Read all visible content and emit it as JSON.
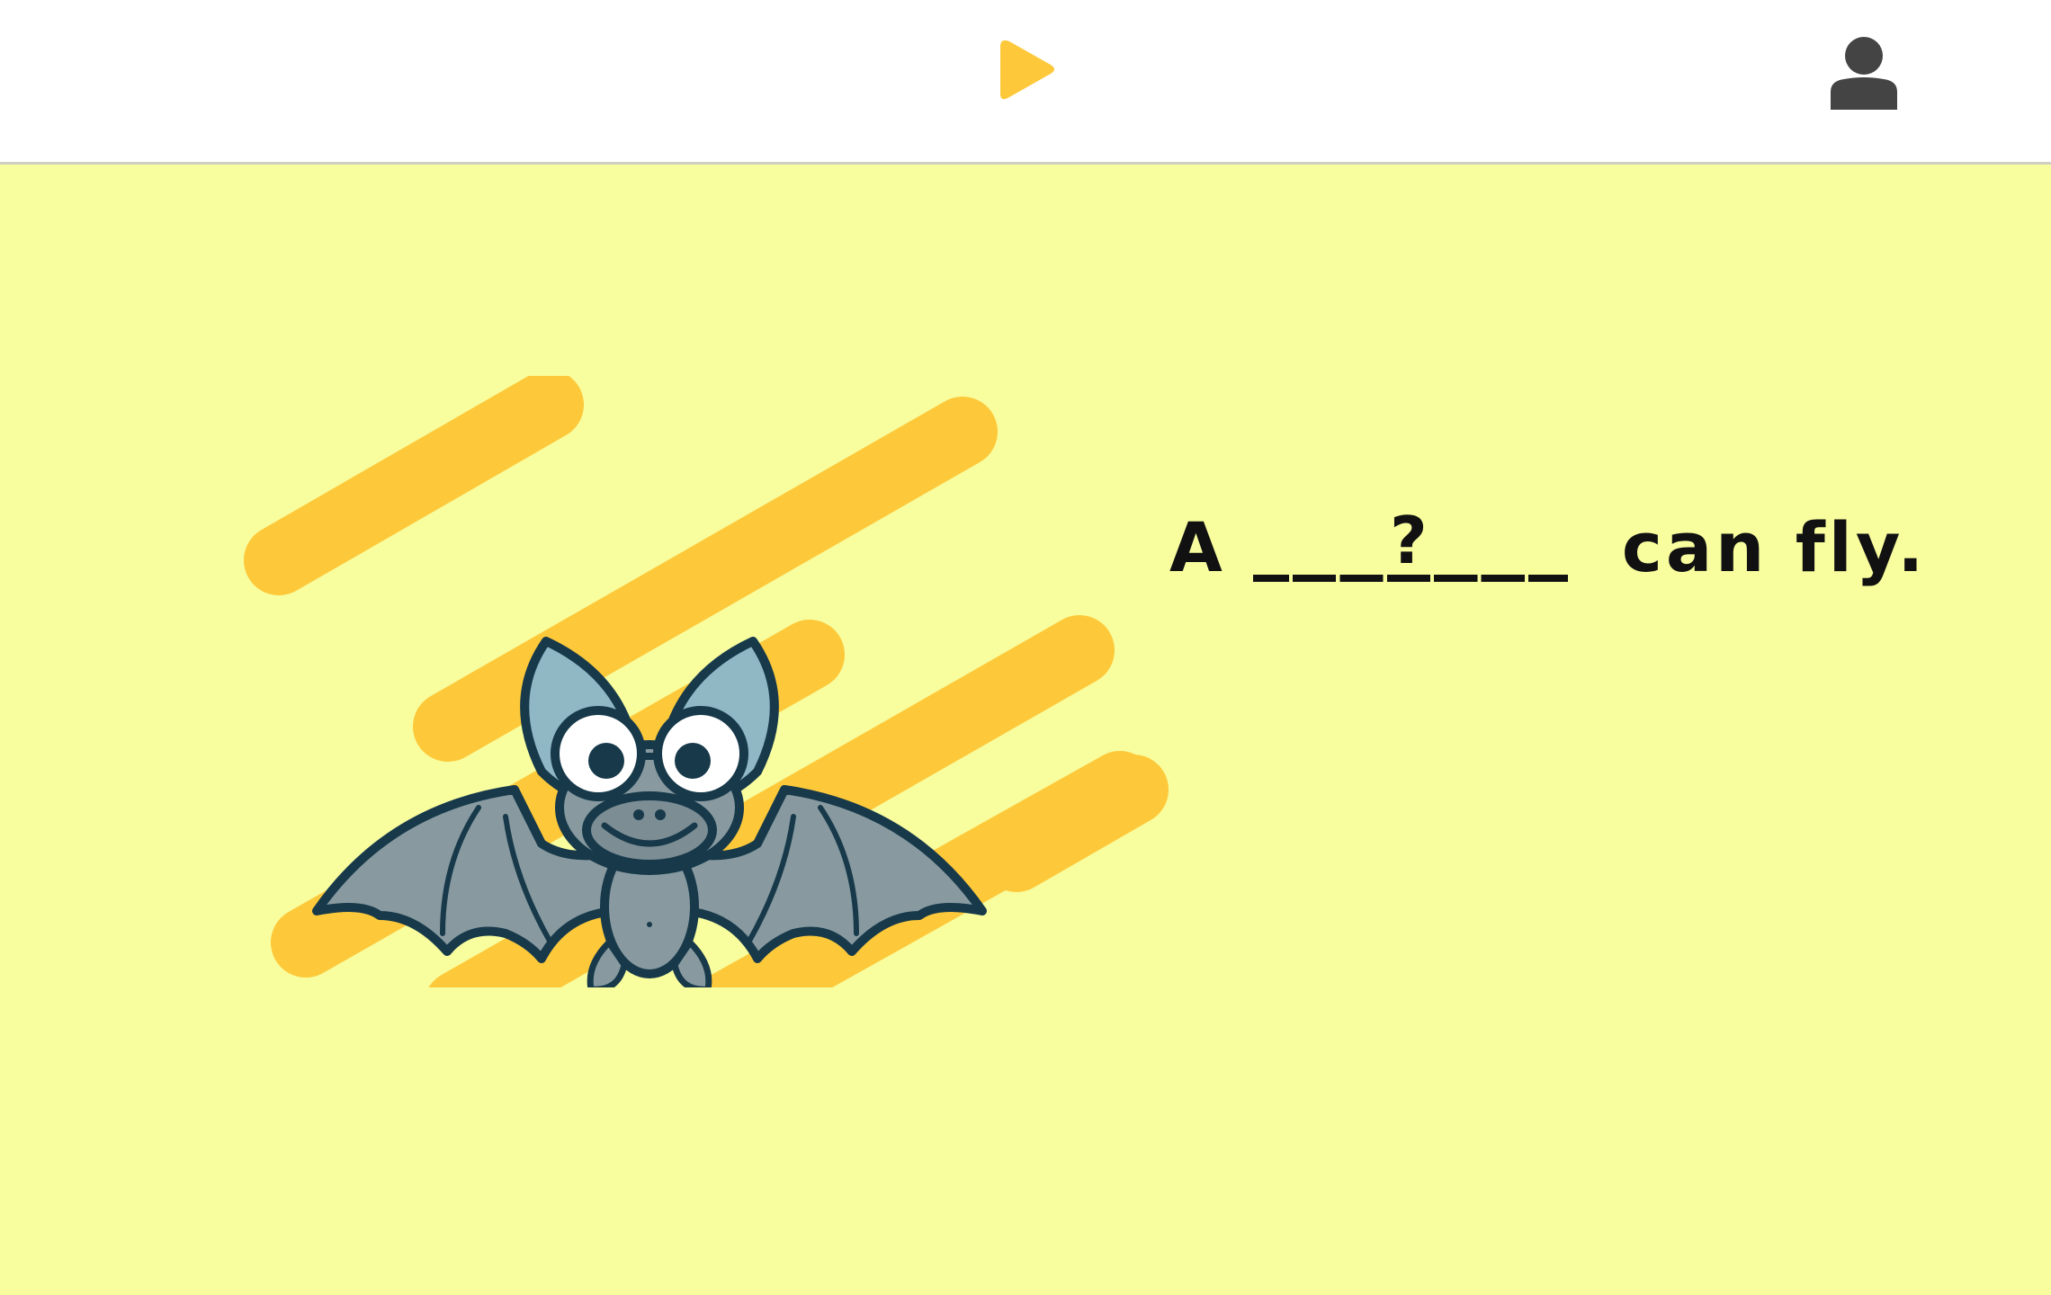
{
  "colors": {
    "background": "#f8fd9e",
    "topbar": "#ffffff",
    "accent": "#fdc93a",
    "text": "#111111",
    "user_icon": "#444444"
  },
  "topbar": {
    "play_icon": "play-icon",
    "user_icon": "user-icon"
  },
  "illustration": {
    "subject": "bat-icon"
  },
  "sentence": {
    "before": "A",
    "blank_mark": "?",
    "after": "can fly."
  }
}
